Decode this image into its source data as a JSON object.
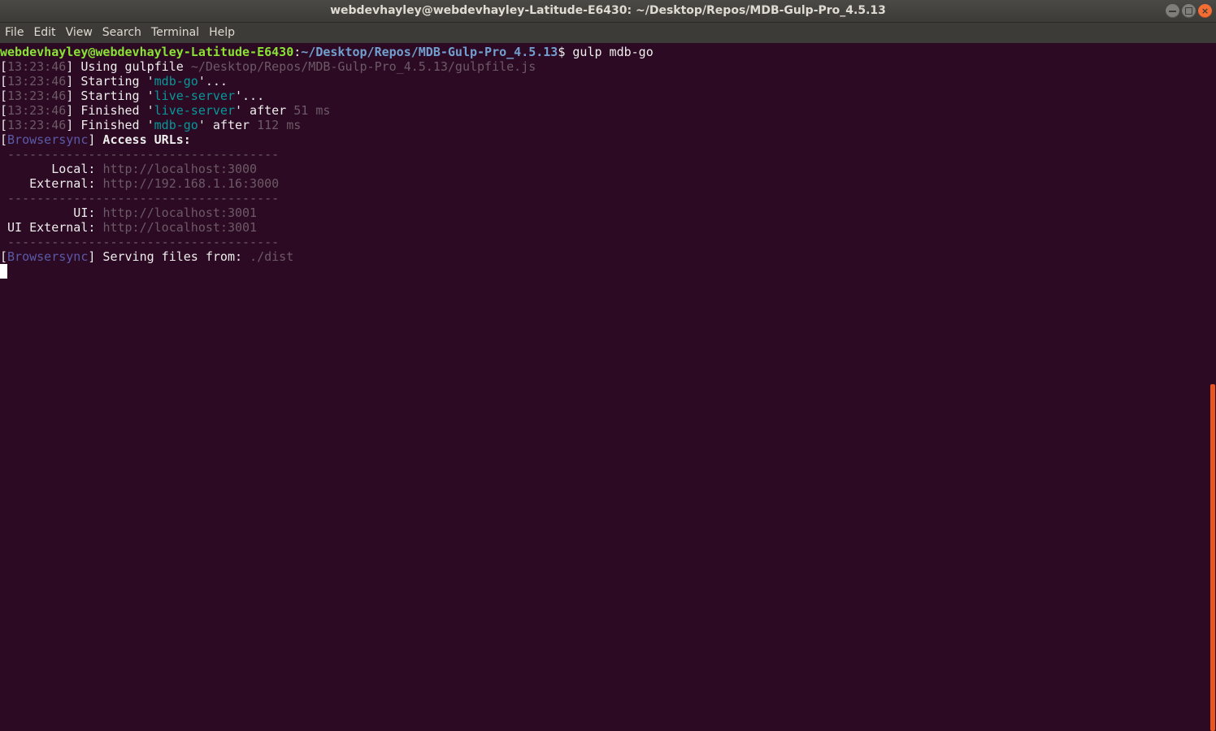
{
  "window": {
    "title": "webdevhayley@webdevhayley-Latitude-E6430: ~/Desktop/Repos/MDB-Gulp-Pro_4.5.13",
    "close_symbol": "×"
  },
  "menu": [
    "File",
    "Edit",
    "View",
    "Search",
    "Terminal",
    "Help"
  ],
  "terminal": {
    "prompt": {
      "user_host": "webdevhayley@webdevhayley-Latitude-E6430",
      "colon": ":",
      "path": "~/Desktop/Repos/MDB-Gulp-Pro_4.5.13",
      "dollar": "$",
      "command": " gulp mdb-go"
    },
    "timestamp": "13:23:46",
    "bracket_open": "[",
    "bracket_close": "]",
    "log": [
      {
        "pre": " Using gulpfile ",
        "hl": "~/Desktop/Repos/MDB-Gulp-Pro_4.5.13/gulpfile.js",
        "hl_style": "gr",
        "post": ""
      },
      {
        "pre": " Starting '",
        "hl": "mdb-go",
        "hl_style": "cy",
        "post": "'..."
      },
      {
        "pre": " Starting '",
        "hl": "live-server",
        "hl_style": "cy",
        "post": "'..."
      },
      {
        "pre": " Finished '",
        "hl": "live-server",
        "hl_style": "cy",
        "post": "' after ",
        "extra": "51 ms"
      },
      {
        "pre": " Finished '",
        "hl": "mdb-go",
        "hl_style": "cy",
        "post": "' after ",
        "extra": "112 ms"
      }
    ],
    "browsersync_tag": "Browsersync",
    "access_urls": " Access URLs:",
    "separator": " -------------------------------------",
    "urls": [
      {
        "label": "       Local: ",
        "url": "http://localhost:3000"
      },
      {
        "label": "    External: ",
        "url": "http://192.168.1.16:3000"
      },
      {
        "label": "          UI: ",
        "url": "http://localhost:3001"
      },
      {
        "label": " UI External: ",
        "url": "http://localhost:3001"
      }
    ],
    "serving": " Serving files from: ",
    "serving_dir": "./dist"
  },
  "colors": {
    "background": "#2c0a23",
    "accent": "#e95420",
    "prompt_user": "#8ae234",
    "prompt_path": "#729fcf",
    "dim": "#6c5a66",
    "cyan": "#06989a",
    "browsersync": "#5a5aa8"
  },
  "icons": [
    "minimize-icon",
    "maximize-icon",
    "close-icon"
  ]
}
